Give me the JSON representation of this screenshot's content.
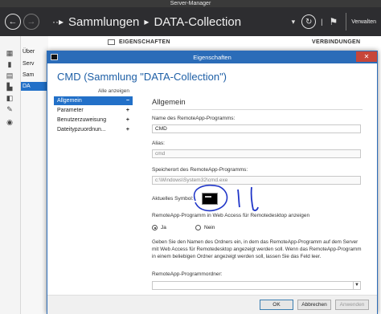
{
  "window": {
    "title": "Server-Manager"
  },
  "header": {
    "breadcrumb": [
      "Sammlungen",
      "DATA-Collection"
    ],
    "manage_label": "Verwalten"
  },
  "left_list": {
    "items": [
      "Über",
      "Serv",
      "Sam",
      "DA"
    ]
  },
  "sections": {
    "properties": "EIGENSCHAFTEN",
    "connections": "VERBINDUNGEN"
  },
  "dialog": {
    "title": "Eigenschaften",
    "heading": "CMD (Sammlung \"DATA-Collection\")",
    "show_all": "Alle anzeigen",
    "nav": [
      {
        "label": "Allgemein",
        "sign": "−"
      },
      {
        "label": "Parameter",
        "sign": "+"
      },
      {
        "label": "Benutzerzuweisung",
        "sign": "+"
      },
      {
        "label": "Dateitypzuordnun...",
        "sign": "+"
      }
    ],
    "section_title": "Allgemein",
    "name_label": "Name des RemoteApp-Programms:",
    "name_value": "CMD",
    "alias_label": "Alias:",
    "alias_value": "cmd",
    "path_label": "Speicherort des RemoteApp-Programms:",
    "path_value": "c:\\Windows\\System32\\cmd.exe",
    "symbol_label": "Aktuelles Symbol:",
    "webaccess_label": "RemoteApp-Programm in Web Access für Remotedesktop anzeigen",
    "radio_yes": "Ja",
    "radio_no": "Nein",
    "description": "Geben Sie den Namen des Ordners ein, in dem das RemoteApp-Programm auf dem Server mit Web Access für Remotedesktop angezeigt werden soll. Wenn das RemoteApp-Programm in einem beliebigen Ordner angezeigt werden soll, lassen Sie das Feld leer.",
    "folder_label": "RemoteApp-Programmordner:",
    "folder_value": "",
    "buttons": {
      "ok": "OK",
      "cancel": "Abbrechen",
      "apply": "Anwenden"
    }
  }
}
